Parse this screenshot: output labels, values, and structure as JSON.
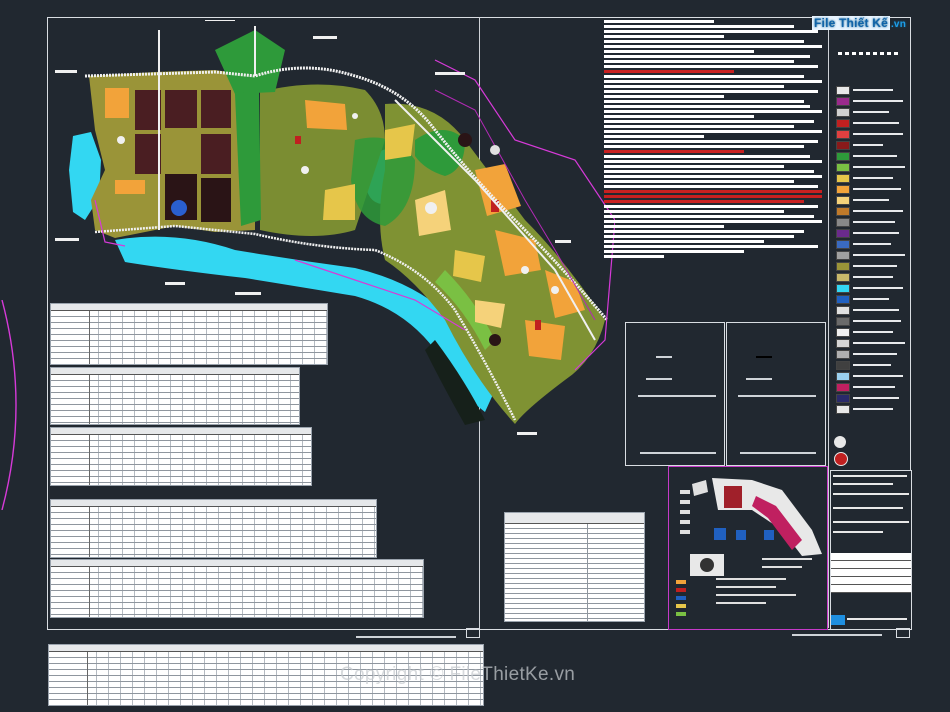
{
  "brand": {
    "logo_text": "File Thiết Kế",
    "logo_suffix": ".vn"
  },
  "watermark": "Copyright © FileThietKe.vn",
  "colors": {
    "background": "#212830",
    "residential_orange": "#f2a33a",
    "mixed_use_yellow": "#e6c64a",
    "green_space": "#2e9a3a",
    "water": "#33d7f2",
    "admin_maroon": "#4a1e22",
    "boundary_magenta": "#d63ad8",
    "olive_zone": "#9a9438"
  },
  "legend_colors": [
    "#e8e8e8",
    "#9a2a8c",
    "#d0d0d0",
    "#c02020",
    "#e04040",
    "#8a1a1a",
    "#2e9a3a",
    "#7ac043",
    "#e6c64a",
    "#f2a33a",
    "#f5d27a",
    "#c07a2a",
    "#888888",
    "#6a2a8c",
    "#3a6ac0",
    "#a0a0a0",
    "#9a9438",
    "#c8b86a",
    "#33d7f2",
    "#2060c0",
    "#e0e0e0",
    "#6a6a6a",
    "#f0f0f0",
    "#d6d6d6",
    "#b0b0b0",
    "#404040",
    "#9ad0f0",
    "#c02060",
    "#2a2a6a",
    "#e8e8e8"
  ]
}
